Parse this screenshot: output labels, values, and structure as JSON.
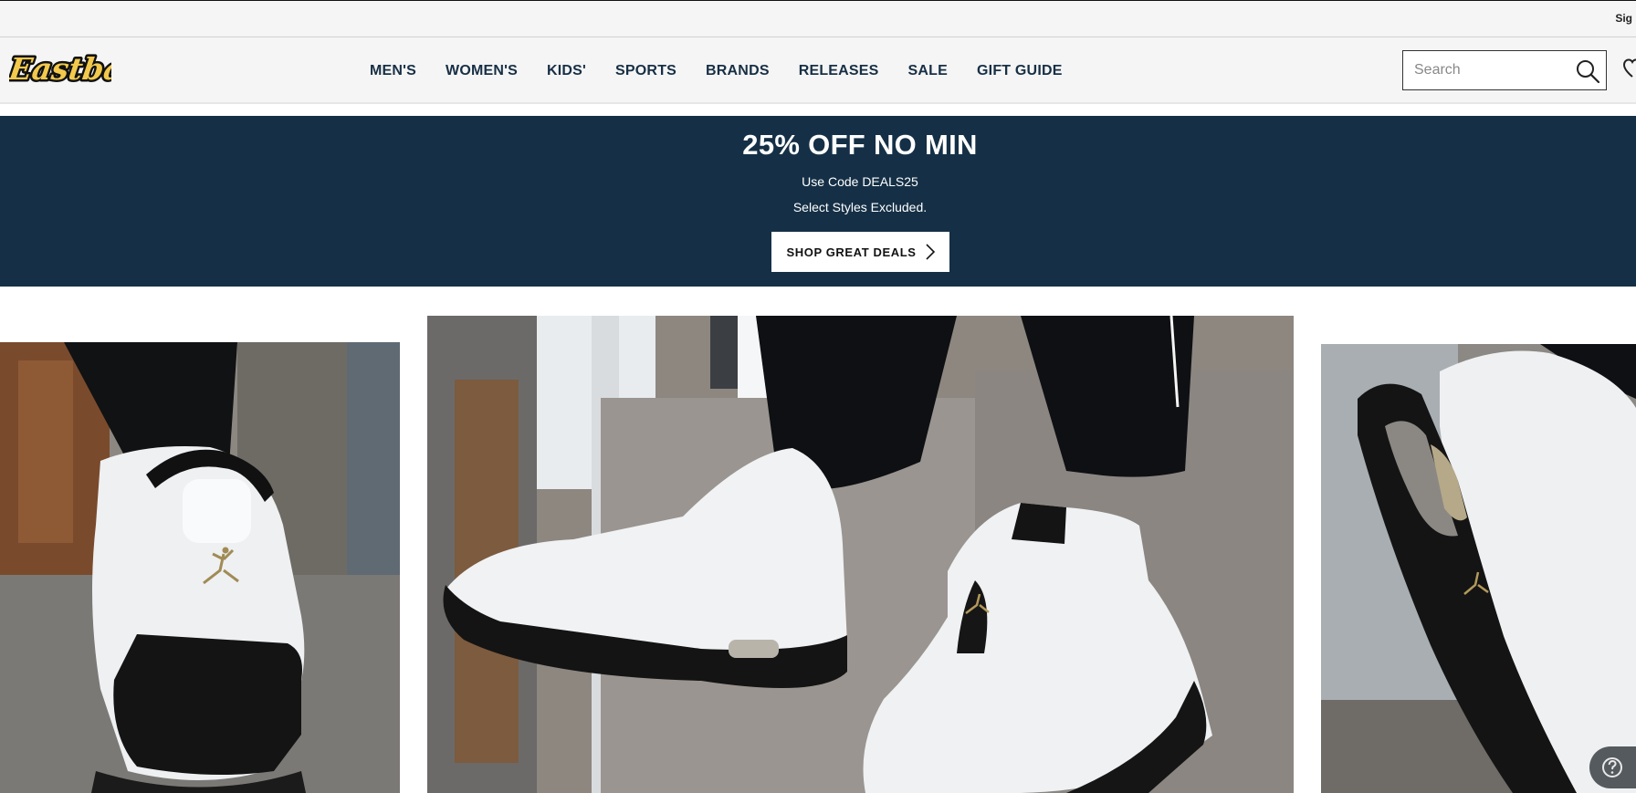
{
  "utility_bar": {
    "sign_in_label": "Sig"
  },
  "header": {
    "logo_text": "Eastbay",
    "nav": [
      "MEN'S",
      "WOMEN'S",
      "KIDS'",
      "SPORTS",
      "BRANDS",
      "RELEASES",
      "SALE",
      "GIFT GUIDE"
    ],
    "search": {
      "placeholder": "Search"
    }
  },
  "promo": {
    "title": "25% OFF NO MIN",
    "line1": "Use Code DEALS25",
    "line2": "Select Styles Excluded.",
    "button_label": "SHOP GREAT DEALS"
  },
  "carousel": {
    "slides": [
      {
        "name": "sneaker-back-view"
      },
      {
        "name": "sneaker-side-pair"
      },
      {
        "name": "sneaker-sole-view"
      }
    ]
  },
  "colors": {
    "brand_navy": "#153046",
    "nav_text": "#172f45",
    "logo_gold": "#f2c94c"
  }
}
